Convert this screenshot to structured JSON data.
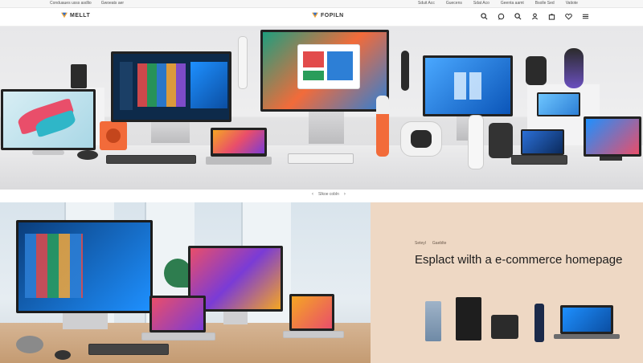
{
  "topbar": {
    "left_links": [
      "Conduaues usss asdlio",
      "Gwoeats aer"
    ],
    "right_links": [
      "Sduit Acc",
      "Guecens",
      "Sdat Aco",
      "Geenta aamt",
      "Bsolle Sed",
      "Vatiote"
    ]
  },
  "header": {
    "brand_left": "MELLT",
    "brand_center": "FOPILN",
    "icons": [
      "search-icon",
      "chat-icon",
      "search-icon",
      "user-icon",
      "bag-icon",
      "heart-icon",
      "menu-icon"
    ]
  },
  "carousel": {
    "label": "Slkoe cobln",
    "prev": "‹",
    "next": "›"
  },
  "promo": {
    "tags": [
      "Seteyl",
      "Gaeblte"
    ],
    "title": "Esplact wilth a e-commerce homepage"
  },
  "colors": {
    "hero_bg": "#e7e7e9",
    "promo_bg": "#eed8c4",
    "accent_orange": "#f26b3a",
    "accent_blue": "#1f7fd6"
  }
}
